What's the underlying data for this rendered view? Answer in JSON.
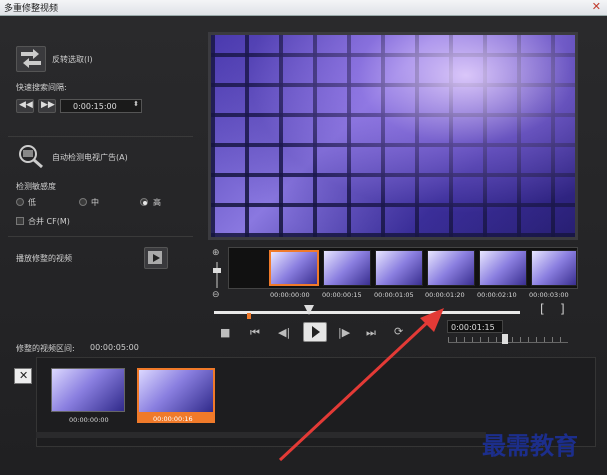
{
  "window": {
    "title": "多重修整视频",
    "close": "✕"
  },
  "left": {
    "reverse_selection": "反转选取(I)",
    "fast_search_label": "快速搜索间隔:",
    "fast_search_value": "0:00:15:00",
    "auto_detect": "自动检测电视广告(A)",
    "sensitivity_label": "检测敏感度",
    "sensitivity_options": [
      "低",
      "中",
      "高"
    ],
    "sensitivity_selected": "高",
    "merge_label": "合并 CF(M)",
    "play_trimmed": "播放修整的视频"
  },
  "timeline": {
    "timecodes": [
      "00:00:00:00",
      "00:00:00:15",
      "00:00:01:05",
      "00:00:01:20",
      "00:00:02:10",
      "00:00:03:00"
    ],
    "current_time": "0:00:01:15",
    "bracket_in": "[",
    "bracket_out": "]"
  },
  "clips": {
    "label": "修整的视频区间:",
    "total": "00:00:05:00",
    "items": [
      {
        "time": "00:00:00:00",
        "selected": false
      },
      {
        "time": "00:00:00:16",
        "selected": true
      }
    ]
  },
  "watermark": "最需教育",
  "colors": {
    "accent": "#f07a2a",
    "arrow": "#e33a36"
  }
}
